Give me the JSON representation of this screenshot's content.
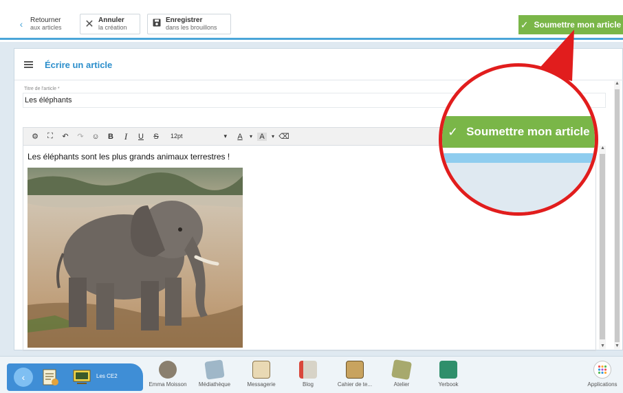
{
  "topbar": {
    "back_line1": "Retourner",
    "back_line2": "aux articles",
    "cancel_line1": "Annuler",
    "cancel_line2": "la création",
    "save_line1": "Enregistrer",
    "save_line2": "dans les brouillons",
    "submit_label": "Soumettre mon article"
  },
  "panel": {
    "title": "Écrire un article",
    "title_field_label": "Titre de l'article *",
    "title_field_value": "Les éléphants"
  },
  "editor": {
    "font_size": "12pt",
    "content_text": "Les éléphants sont les plus grands animaux terrestres !"
  },
  "callout": {
    "zoom_label": "Soumettre mon article"
  },
  "dock": {
    "class_label": "Les CE2",
    "items": [
      {
        "label": "Emma Moisson"
      },
      {
        "label": "Médiathèque"
      },
      {
        "label": "Messagerie"
      },
      {
        "label": "Blog"
      },
      {
        "label": "Cahier de te..."
      },
      {
        "label": "Atelier"
      },
      {
        "label": "Yerbook"
      }
    ],
    "apps_label": "Applications"
  },
  "colors": {
    "accent_blue": "#2b8ecb",
    "submit_green": "#7ab648",
    "callout_red": "#e11d1d"
  }
}
